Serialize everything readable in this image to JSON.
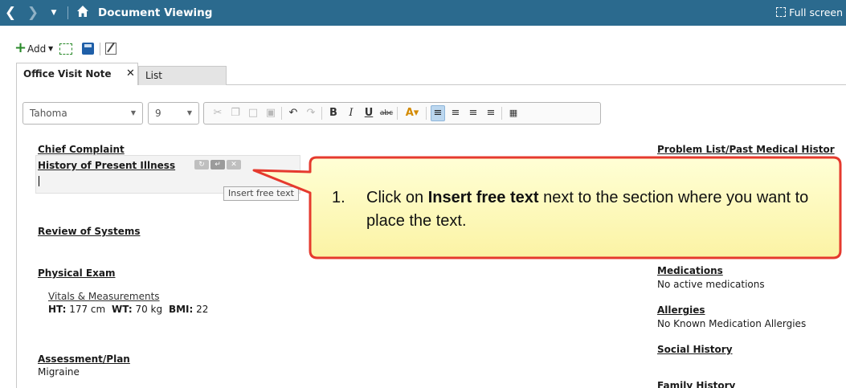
{
  "titlebar": {
    "back_icon": "chevron-left-icon",
    "forward_icon": "chevron-right-icon",
    "dropdown_icon": "caret-down-icon",
    "home_icon": "home-icon",
    "title": "Document Viewing",
    "full_screen_label": "Full screen",
    "bg_color": "#2b6a8e"
  },
  "toolbar": {
    "add_label": "Add",
    "icons": [
      "plus-icon",
      "caret-down-icon",
      "frame-icon",
      "save-icon",
      "edit-note-icon"
    ]
  },
  "tabs": [
    {
      "label": "Office Visit Note",
      "active": true,
      "close": "✕"
    },
    {
      "label": "List",
      "active": false
    }
  ],
  "format_bar": {
    "font": "Tahoma",
    "size": "9"
  },
  "document": {
    "chief_complaint": "Chief Complaint",
    "hpi": "History of Present Illness",
    "ros": "Review of Systems",
    "physical_exam": "Physical Exam",
    "vitals_link": "Vitals & Measurements",
    "vitals": {
      "ht_label": "HT:",
      "ht_value": "177 cm",
      "wt_label": "WT:",
      "wt_value": "70 kg",
      "bmi_label": "BMI:",
      "bmi_value": "22"
    },
    "assessment_plan": "Assessment/Plan",
    "assessment_value": "Migraine",
    "problem_list": "Problem List/Past Medical Histor",
    "medications": "Medications",
    "medications_value": "No active medications",
    "allergies": "Allergies",
    "allergies_value": "No Known Medication Allergies",
    "social_history": "Social History",
    "family_history": "Family History"
  },
  "tooltip": "Insert free text",
  "callout": {
    "number": "1.",
    "text_before": "Click on ",
    "text_bold": "Insert free text",
    "text_after": " next to the section where you want to place the text.",
    "fill_color": "#ffffc6",
    "border_color": "#e53a2e"
  }
}
